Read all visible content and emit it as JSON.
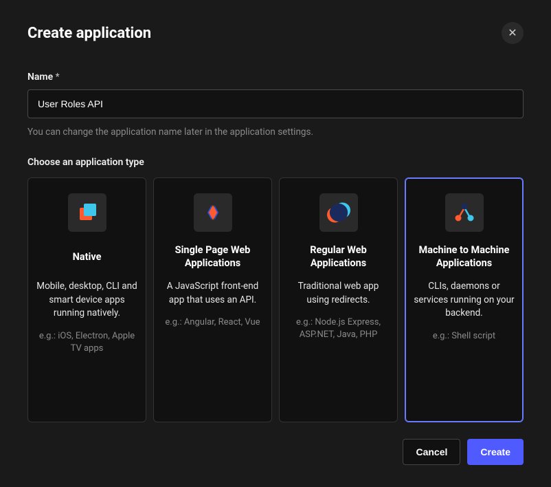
{
  "dialog": {
    "title": "Create application",
    "close_label": "✕"
  },
  "form": {
    "name_label": "Name",
    "name_required": "*",
    "name_value": "User Roles API",
    "name_helper": "You can change the application name later in the application settings.",
    "type_label": "Choose an application type"
  },
  "cards": [
    {
      "icon": "native-icon",
      "title": "Native",
      "desc": "Mobile, desktop, CLI and smart device apps running natively.",
      "eg": "e.g.: iOS, Electron, Apple TV apps",
      "selected": false
    },
    {
      "icon": "spa-icon",
      "title": "Single Page Web Applications",
      "desc": "A JavaScript front-end app that uses an API.",
      "eg": "e.g.: Angular, React, Vue",
      "selected": false
    },
    {
      "icon": "regular-web-icon",
      "title": "Regular Web Applications",
      "desc": "Traditional web app using redirects.",
      "eg": "e.g.: Node.js Express, ASP.NET, Java, PHP",
      "selected": false
    },
    {
      "icon": "m2m-icon",
      "title": "Machine to Machine Applications",
      "desc": "CLIs, daemons or services running on your backend.",
      "eg": "e.g.: Shell script",
      "selected": true
    }
  ],
  "footer": {
    "cancel": "Cancel",
    "create": "Create"
  }
}
